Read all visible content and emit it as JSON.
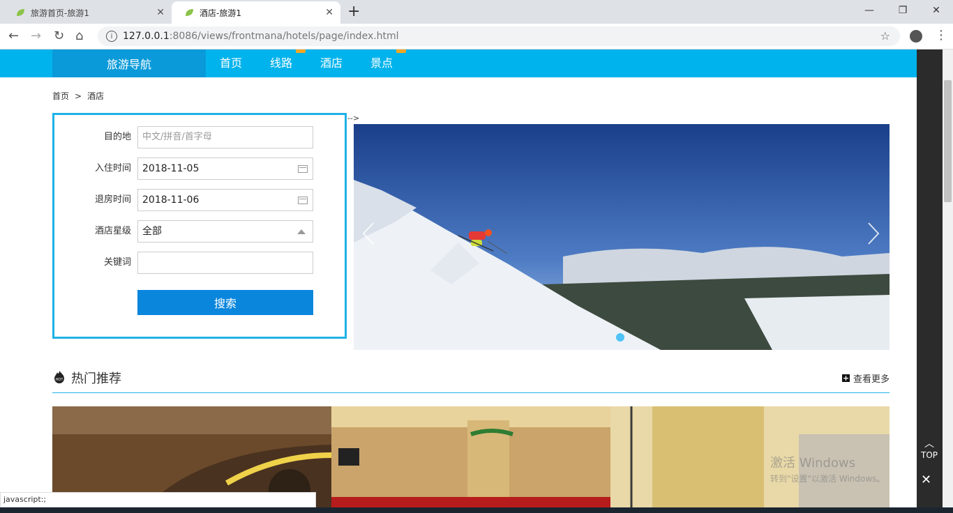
{
  "browser": {
    "tabs": [
      {
        "title": "旅游首页-旅游1"
      },
      {
        "title": "酒店-旅游1"
      }
    ],
    "url_host": "127.0.0.1",
    "url_path": ":8086/views/frontmana/hotels/page/index.html",
    "status_text": "javascript:;"
  },
  "nav": {
    "brand": "旅游导航",
    "items": [
      "首页",
      "线路",
      "酒店",
      "景点"
    ]
  },
  "breadcrumb": {
    "home": "首页",
    "sep": ">",
    "current": "酒店"
  },
  "stray_text": "-->",
  "search": {
    "destination_label": "目的地",
    "destination_placeholder": "中文/拼音/首字母",
    "checkin_label": "入住时间",
    "checkin_value": "2018-11-05",
    "checkout_label": "退房时间",
    "checkout_value": "2018-11-06",
    "star_label": "酒店星级",
    "star_value": "全部",
    "keyword_label": "关键词",
    "keyword_value": "",
    "button": "搜索"
  },
  "hot": {
    "title": "热门推荐",
    "more": "查看更多"
  },
  "overlay": {
    "top": "TOP",
    "watermark_line1": "激活 Windows",
    "watermark_line2": "转到\"设置\"以激活 Windows。"
  },
  "colors": {
    "nav_bg": "#00b3ec",
    "brand_bg": "#0a9ad9",
    "search_border": "#1eb2e6",
    "button_bg": "#0a86dd"
  }
}
